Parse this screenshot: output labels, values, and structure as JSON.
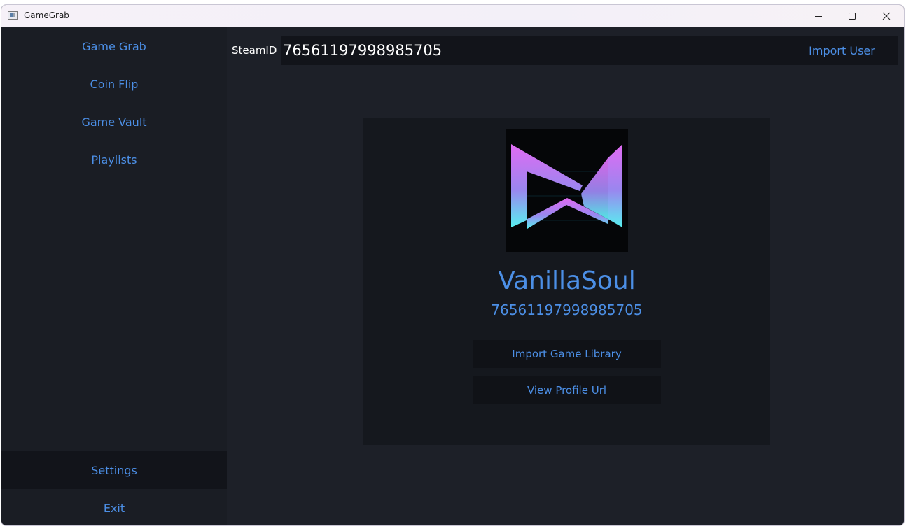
{
  "window": {
    "title": "GameGrab",
    "controls": [
      "minimize-icon",
      "maximize-icon",
      "close-icon"
    ]
  },
  "sidebar": {
    "items": [
      {
        "label": "Game Grab"
      },
      {
        "label": "Coin Flip"
      },
      {
        "label": "Game Vault"
      },
      {
        "label": "Playlists"
      }
    ],
    "settings_label": "Settings",
    "exit_label": "Exit"
  },
  "search": {
    "label": "SteamID",
    "value": "76561197998985705",
    "import_label": "Import User"
  },
  "profile": {
    "username": "VanillaSoul",
    "steam_id": "76561197998985705",
    "import_library_label": "Import Game Library",
    "view_profile_label": "View Profile Url"
  },
  "colors": {
    "accent": "#4c8fe6",
    "background": "#1d2028",
    "panel": "#15181e",
    "input": "#12141a"
  }
}
